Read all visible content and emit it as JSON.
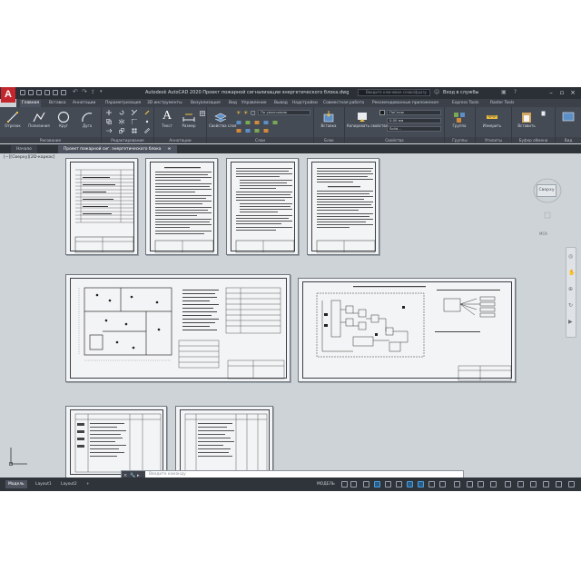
{
  "app": {
    "logo_letter": "A",
    "title": "Autodesk AutoCAD 2020   Проект пожарной сигнализации энергетического блока.dwg",
    "search_placeholder": "Введите ключевое слово/фразу",
    "sign_in": "Вход в службы",
    "accent": "#c4262e"
  },
  "ribbon_tabs": [
    "Главная",
    "Вставка",
    "Аннотации",
    "Параметризация",
    "3D инструменты",
    "Визуализация",
    "Вид",
    "Управление",
    "Вывод",
    "Надстройки",
    "Совместная работа",
    "Рекомендованные приложения",
    "Express Tools",
    "Raster Tools"
  ],
  "ribbon": {
    "draw": {
      "title": "Рисование",
      "line": "Отрезок",
      "polyline": "Полилиния",
      "circle": "Круг",
      "arc": "Дуга"
    },
    "modify": {
      "title": "Редактирование"
    },
    "annotation": {
      "title": "Аннотации",
      "text": "Текст",
      "dimension": "Размер"
    },
    "layers": {
      "title": "Слои",
      "layer_props": "Свойства слоя",
      "layer_value": "По умолчанию"
    },
    "block": {
      "title": "Блок",
      "insert": "Вставка"
    },
    "properties": {
      "title": "Свойства",
      "match": "Копировать свойства",
      "color": "ПоСлою",
      "lineweight": "0.00 мм",
      "linetype": "Solid..."
    },
    "groups": {
      "title": "Группы",
      "group": "Группа"
    },
    "utilities": {
      "title": "Утилиты",
      "measure": "Измерить"
    },
    "clipboard": {
      "title": "Буфер обмена",
      "paste": "Вставить"
    },
    "view": {
      "title": "Вид"
    }
  },
  "file_tabs": {
    "start": "Начало",
    "document": "Проект пожарной сиг. энергетического блока",
    "add": "+"
  },
  "canvas": {
    "viewport_label": "[−][Сверху][2D-каркас]",
    "viewcube_face": "Сверху",
    "wcs": "МСК"
  },
  "command_line": {
    "placeholder": "Введите команду"
  },
  "status": {
    "model_tab": "Модель",
    "layout1": "Layout1",
    "layout2": "Layout2",
    "add": "+",
    "model_label": "МОДЕЛЬ"
  }
}
